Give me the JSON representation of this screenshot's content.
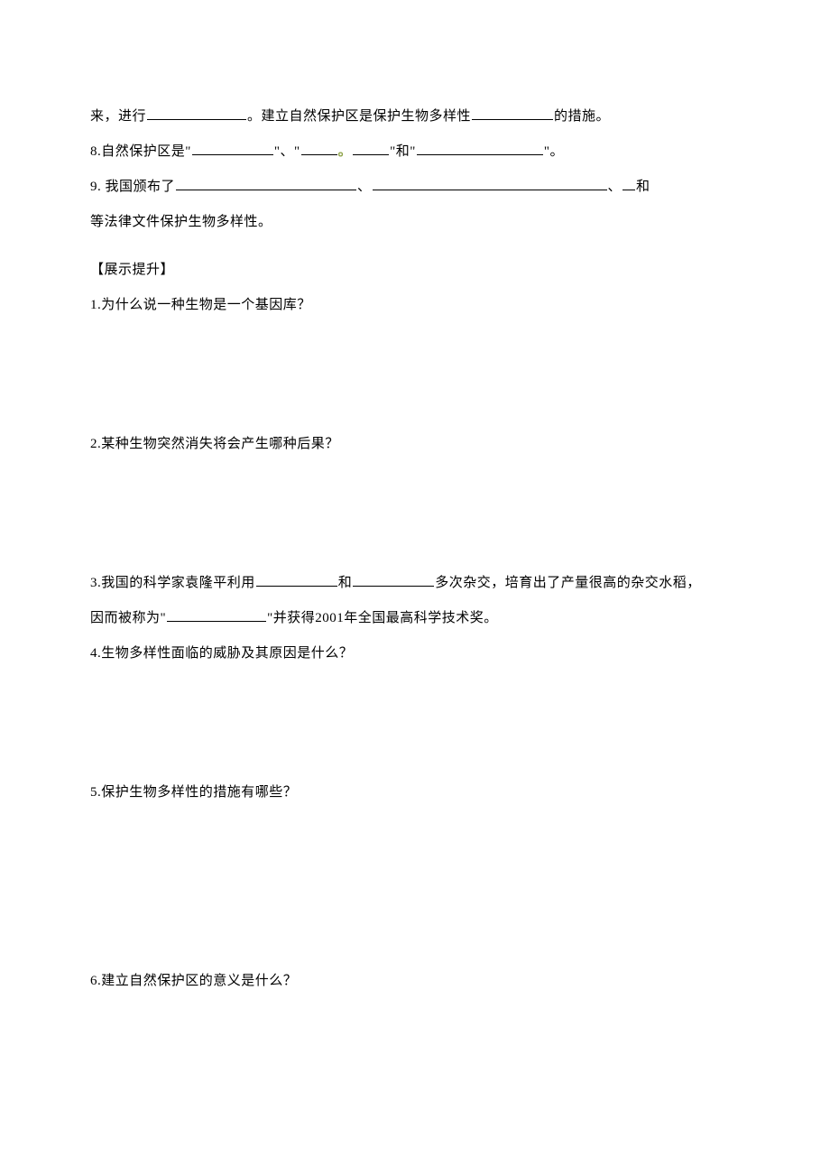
{
  "lines": {
    "l1a": "来，进行",
    "l1b": "。建立自然保护区是保护生物多样性",
    "l1c": "的措施。",
    "l2a": "8.自然保护区是\"",
    "l2b": "\"、\"",
    "l2c": "\"和\"",
    "l2d": "\"。",
    "l3a": "9. 我国颁布了",
    "l3b": "、",
    "l3c": "、",
    "l3d": "和",
    "l4": "等法律文件保护生物多样性。",
    "section": "【展示提升】",
    "q1": "1.为什么说一种生物是一个基因库？",
    "q2": "2.某种生物突然消失将会产生哪种后果？",
    "q3a": "3.我国的科学家袁隆平利用",
    "q3b": "和",
    "q3c": "多次杂交，培育出了产量很高的杂交水稻，",
    "q3d": "因而被称为\"",
    "q3e": "\"并获得2001年全国最高科学技术奖。",
    "q4": "4.生物多样性面临的威胁及其原因是什么？",
    "q5": "5.保护生物多样性的措施有哪些？",
    "q6": "6.建立自然保护区的意义是什么？",
    "dot": "。"
  }
}
